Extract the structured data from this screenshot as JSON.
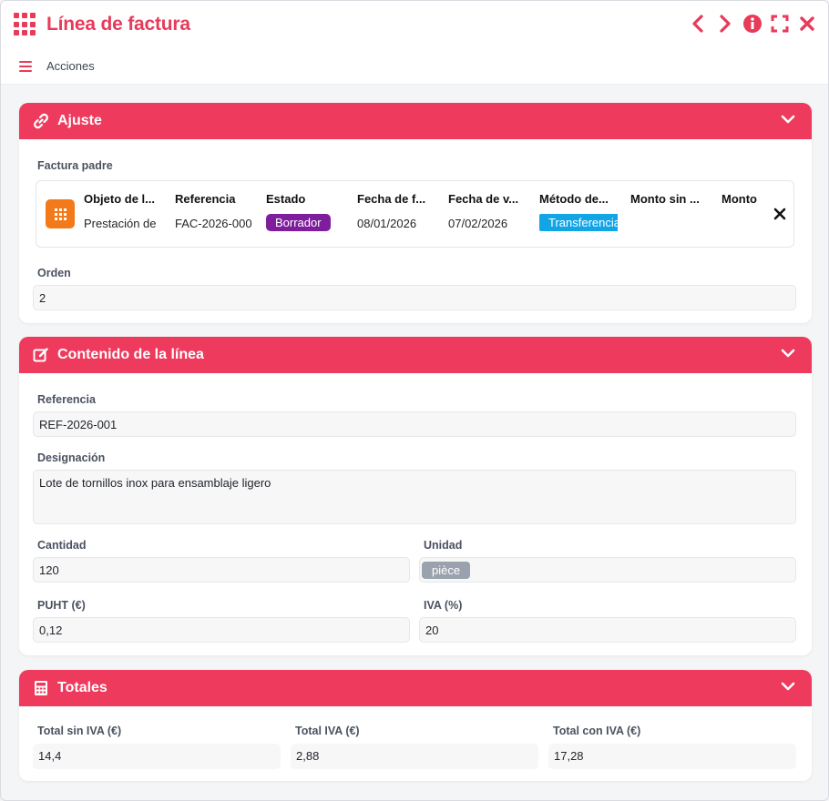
{
  "window": {
    "title": "Línea de factura",
    "accent": "#e83a59"
  },
  "toolbar": {
    "actions_label": "Acciones"
  },
  "panels": {
    "ajuste": {
      "title": "Ajuste",
      "icon": "link-icon",
      "parent_label": "Factura padre",
      "parent_columns": [
        {
          "header": "Objeto de l...",
          "value": "Prestación de"
        },
        {
          "header": "Referencia",
          "value": "FAC-2026-000"
        },
        {
          "header": "Estado",
          "value": "Borrador",
          "badge_color": "#7e1e9c"
        },
        {
          "header": "Fecha de f...",
          "value": "08/01/2026"
        },
        {
          "header": "Fecha de v...",
          "value": "07/02/2026"
        },
        {
          "header": "Método de...",
          "value": "Transferencia",
          "badge_color": "#12a5e6"
        },
        {
          "header": "Monto sin ...",
          "value": ""
        },
        {
          "header": "Monto",
          "value": ""
        }
      ],
      "order_label": "Orden",
      "order_value": "2"
    },
    "contenido": {
      "title": "Contenido de la línea",
      "icon": "edit-icon",
      "reference_label": "Referencia",
      "reference_value": "REF-2026-001",
      "designation_label": "Designación",
      "designation_value": "Lote de tornillos inox para ensamblaje ligero",
      "quantity_label": "Cantidad",
      "quantity_value": "120",
      "unit_label": "Unidad",
      "unit_value": "pièce",
      "unit_badge_color": "#9aa3ad",
      "puht_label": "PUHT (€)",
      "puht_value": "0,12",
      "iva_label": "IVA (%)",
      "iva_value": "20"
    },
    "totales": {
      "title": "Totales",
      "icon": "calculator-icon",
      "sin_iva_label": "Total sin IVA (€)",
      "sin_iva_value": "14,4",
      "iva_label": "Total IVA (€)",
      "iva_value": "2,88",
      "con_iva_label": "Total con IVA (€)",
      "con_iva_value": "17,28"
    }
  }
}
